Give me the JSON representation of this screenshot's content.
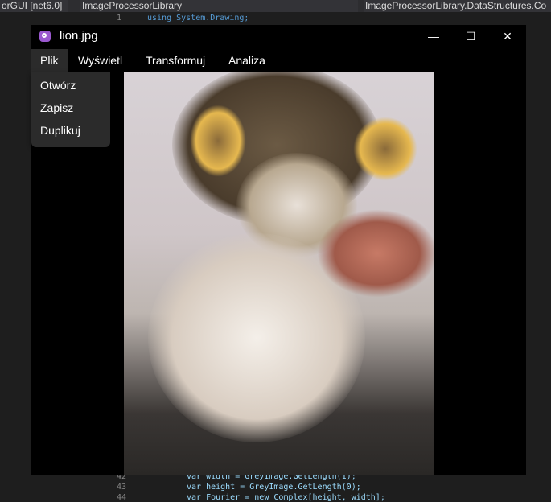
{
  "ide": {
    "project_combo": "orGUI [net6.0]",
    "file_combo": "ImageProcessorLibrary",
    "member_combo": "ImageProcessorLibrary.DataStructures.Co",
    "code_lines": [
      {
        "num": "1",
        "text": "using System.Drawing;"
      },
      {
        "num": "42",
        "text": "var width = GreyImage.GetLength(1);"
      },
      {
        "num": "43",
        "text": "var height = GreyImage.GetLength(0);"
      },
      {
        "num": "44",
        "text": "var Fourier = new Complex[height, width];"
      }
    ]
  },
  "window": {
    "title": "lion.jpg",
    "controls": {
      "minimize": "—",
      "maximize": "☐",
      "close": "✕"
    },
    "menu": [
      {
        "label": "Plik"
      },
      {
        "label": "Wyświetl"
      },
      {
        "label": "Transformuj"
      },
      {
        "label": "Analiza"
      }
    ],
    "open_menu": {
      "items": [
        {
          "label": "Otwórz"
        },
        {
          "label": "Zapisz"
        },
        {
          "label": "Duplikuj"
        }
      ]
    },
    "accent": "#9b59d0"
  }
}
